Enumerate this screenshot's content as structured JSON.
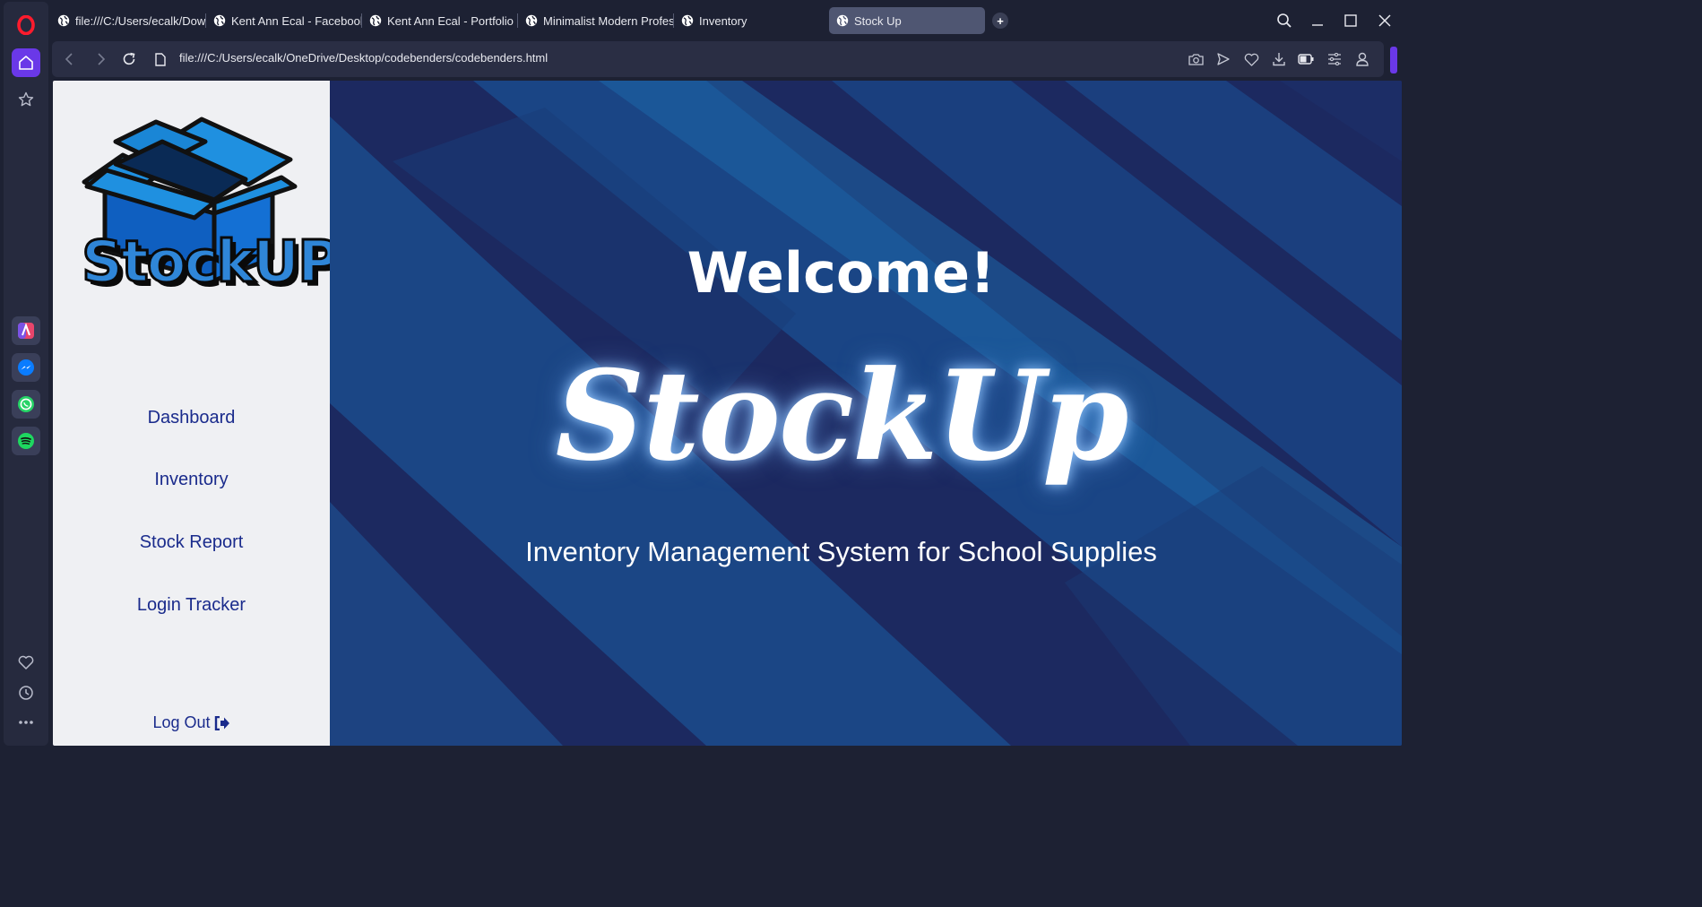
{
  "browser": {
    "tabs": [
      {
        "title": "file:///C:/Users/ecalk/Down",
        "active": false
      },
      {
        "title": "Kent Ann Ecal - Facebook",
        "active": false
      },
      {
        "title": "Kent Ann Ecal - Portfolio |",
        "active": false
      },
      {
        "title": "Minimalist Modern Profes",
        "active": false
      },
      {
        "title": "Inventory",
        "active": false
      },
      {
        "title": "Stock Up",
        "active": true
      }
    ],
    "new_tab_glyph": "+",
    "url": "file:///C:/Users/ecalk/OneDrive/Desktop/codebenders/codebenders.html",
    "toolbar_icons": [
      "camera-icon",
      "send-icon",
      "heart-icon",
      "download-icon",
      "battery-icon",
      "easy-setup-icon",
      "profile-icon"
    ],
    "sidebar_icons": [
      "opera-logo",
      "home-icon",
      "star-icon",
      "aria-icon",
      "messenger-icon",
      "whatsapp-icon",
      "spotify-icon",
      "heart-icon",
      "history-icon",
      "more-icon"
    ],
    "colors": {
      "accent": "#6a38e8",
      "home_active": "#6a38e8",
      "whatsapp": "#25d366",
      "spotify": "#1ed760",
      "messenger": "#0a7cff"
    }
  },
  "app": {
    "logo_text": "StockUP",
    "nav": [
      {
        "label": "Dashboard"
      },
      {
        "label": "Inventory"
      },
      {
        "label": "Stock Report"
      },
      {
        "label": "Login Tracker"
      }
    ],
    "logout_label": "Log Out",
    "welcome": "Welcome!",
    "brand": "StockUp",
    "tagline": "Inventory Management System for School Supplies",
    "colors": {
      "nav_text": "#1a2b8c",
      "sidebar_bg": "#eff0f3",
      "hero_bg": "#1c2960",
      "hero_stripe": "#1b4f8f"
    }
  }
}
